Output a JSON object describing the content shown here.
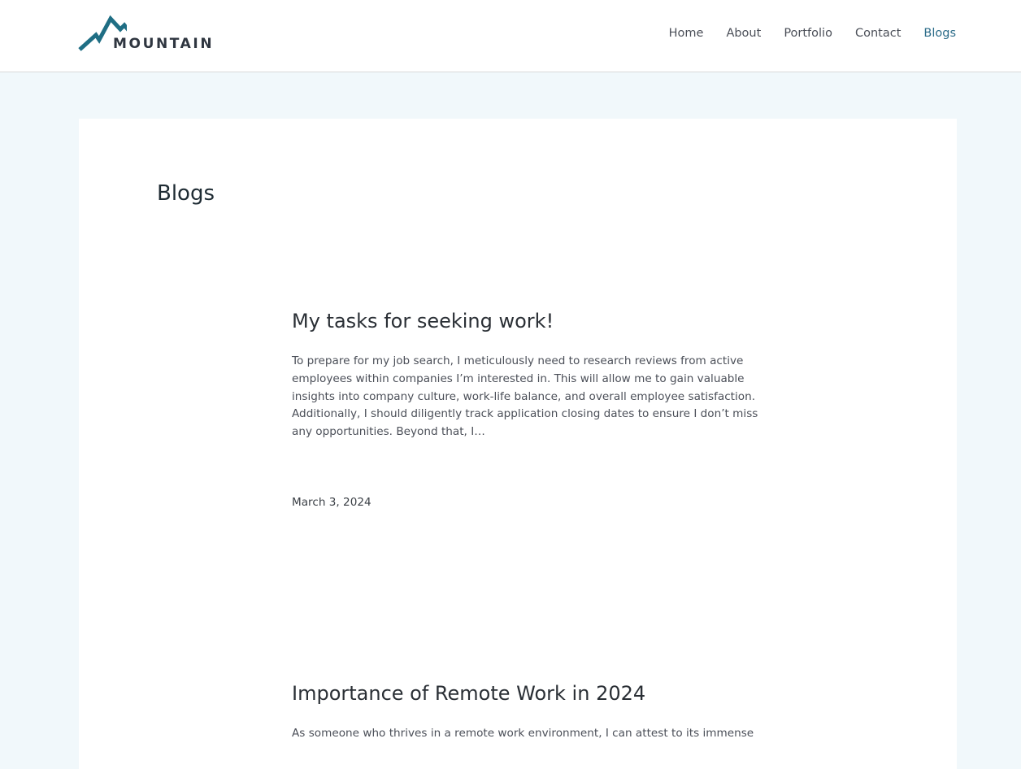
{
  "header": {
    "logo_text": "MOUNTAIN",
    "logo_icon": "mountain-logo-icon",
    "brand_color": "#1f6e84"
  },
  "nav": {
    "items": [
      {
        "label": "Home",
        "active": false
      },
      {
        "label": "About",
        "active": false
      },
      {
        "label": "Portfolio",
        "active": false
      },
      {
        "label": "Contact",
        "active": false
      },
      {
        "label": "Blogs",
        "active": true
      }
    ],
    "active_color": "#2c6c89"
  },
  "main": {
    "title": "Blogs",
    "posts": [
      {
        "title": "My tasks for seeking work!",
        "excerpt": "To prepare for my job search, I meticulously need to research reviews from active employees within companies I’m interested in. This will allow me to gain valuable insights into company culture, work-life balance, and overall employee satisfaction. Additionally, I should diligently track application closing dates to ensure I don’t miss any opportunities. Beyond that, I…",
        "date": "March 3, 2024"
      },
      {
        "title": "Importance of Remote Work in 2024",
        "excerpt": "As someone who thrives in a remote work environment, I can attest to its immense"
      }
    ]
  },
  "colors": {
    "page_background": "#f1f8fb",
    "card_background": "#ffffff",
    "text": "#4b4f58"
  }
}
